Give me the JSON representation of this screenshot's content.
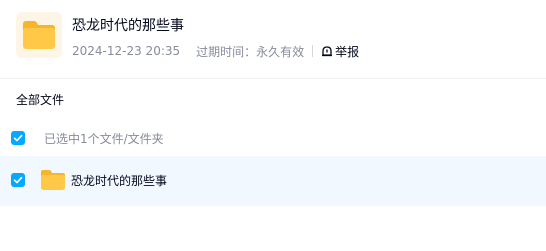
{
  "header": {
    "title": "恐龙时代的那些事",
    "time": "2024-12-23 20:35",
    "expiry_label": "过期时间：",
    "expiry_value": "永久有效",
    "report_label": "举报"
  },
  "breadcrumb": {
    "label": "全部文件"
  },
  "selection": {
    "text": "已选中1个文件/文件夹",
    "checked": true
  },
  "files": [
    {
      "name": "恐龙时代的那些事",
      "checked": true,
      "type": "folder"
    }
  ],
  "colors": {
    "accent": "#06a7ff",
    "row_highlight": "#f2f8ff",
    "folder": "#ffc233",
    "muted_text": "#878c9c",
    "primary_text": "#03081a"
  },
  "icons": {
    "share_icon": "folder-icon",
    "report_icon": "report-icon",
    "checkbox_icon": "check-icon"
  }
}
